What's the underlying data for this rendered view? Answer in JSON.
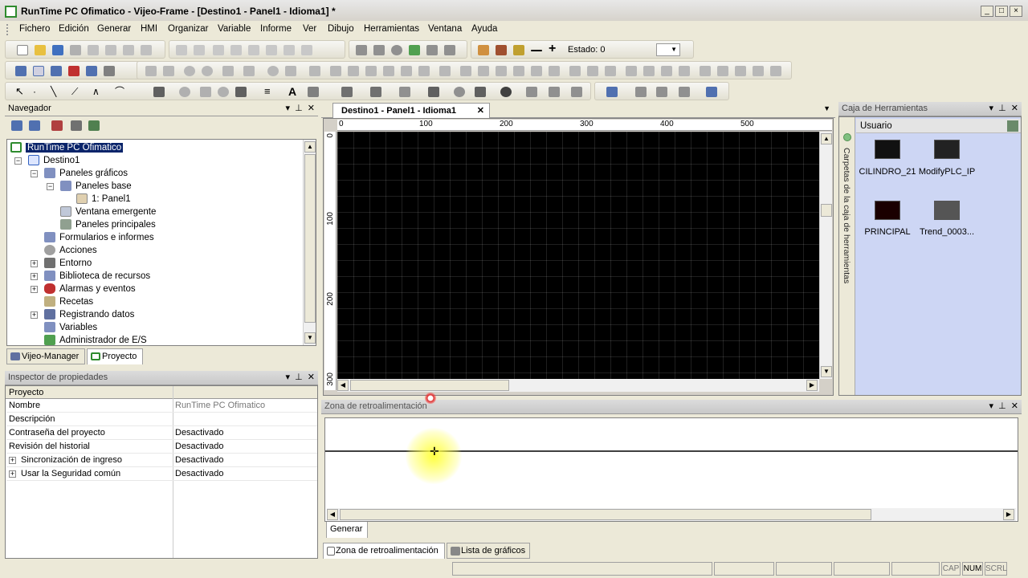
{
  "window": {
    "title": "RunTime PC Ofimatico - Vijeo-Frame - [Destino1 - Panel1 - Idioma1] *",
    "controls": [
      "_",
      "□",
      "×"
    ]
  },
  "menu": [
    "Fichero",
    "Edición",
    "Generar",
    "HMI",
    "Organizar",
    "Variable",
    "Informe",
    "Ver",
    "Dibujo",
    "Herramientas",
    "Ventana",
    "Ayuda"
  ],
  "toolbar": {
    "estado_label": "Estado: 0"
  },
  "navigator": {
    "title": "Navegador",
    "items": [
      {
        "label": "RunTime PC Ofimatico"
      },
      {
        "label": "Destino1"
      },
      {
        "label": "Paneles gráficos"
      },
      {
        "label": "Paneles base"
      },
      {
        "label": "1: Panel1"
      },
      {
        "label": "Ventana emergente"
      },
      {
        "label": "Paneles principales"
      },
      {
        "label": "Formularios e informes"
      },
      {
        "label": "Acciones"
      },
      {
        "label": "Entorno"
      },
      {
        "label": "Biblioteca de recursos"
      },
      {
        "label": "Alarmas y eventos"
      },
      {
        "label": "Recetas"
      },
      {
        "label": "Registrando datos"
      },
      {
        "label": "Variables"
      },
      {
        "label": "Administrador de E/S"
      }
    ],
    "tabs": [
      "Vijeo-Manager",
      "Proyecto"
    ]
  },
  "inspector": {
    "title": "Inspector de propiedades",
    "header": "Proyecto",
    "rows": [
      {
        "key": "Nombre",
        "value": "RunTime PC Ofimatico"
      },
      {
        "key": "Descripción",
        "value": ""
      },
      {
        "key": "Contraseña del proyecto",
        "value": "Desactivado"
      },
      {
        "key": "Revisión del historial",
        "value": "Desactivado"
      },
      {
        "key": "Sincronización de ingreso",
        "value": "Desactivado"
      },
      {
        "key": "Usar la Seguridad común",
        "value": "Desactivado"
      }
    ]
  },
  "editor": {
    "tab_label": "Destino1 - Panel1 - Idioma1",
    "ruler_h": [
      "0",
      "100",
      "200",
      "300",
      "400",
      "500"
    ],
    "ruler_v": [
      "0",
      "100",
      "200",
      "300"
    ]
  },
  "toolbox": {
    "title": "Caja de Herramientas",
    "section": "Usuario",
    "side_label": "Carpetas de la caja de herramientas",
    "items": [
      "CILINDRO_21",
      "ModifyPLC_IP",
      "PRINCIPAL",
      "Trend_0003..."
    ]
  },
  "feedback": {
    "title": "Zona de retroalimentación",
    "subtab": "Generar",
    "bottom_tabs": [
      "Zona de retroalimentación",
      "Lista de gráficos"
    ]
  },
  "status": {
    "cells": [
      "CAP",
      "NUM",
      "SCRL"
    ]
  }
}
